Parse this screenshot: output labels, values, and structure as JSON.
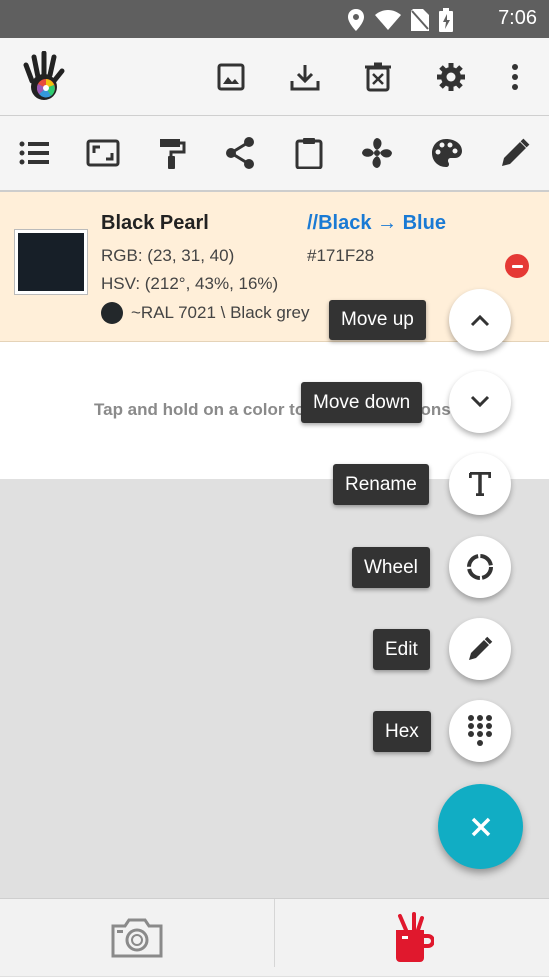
{
  "status_bar": {
    "time": "7:06",
    "icons": [
      "location-icon",
      "wifi-icon",
      "no-sim-icon",
      "battery-charging-icon"
    ]
  },
  "app_bar": {
    "actions": [
      "image-icon",
      "download-icon",
      "delete-icon",
      "settings-icon",
      "more-vert-icon"
    ]
  },
  "toolbar": {
    "actions": [
      "list-icon",
      "crop-icon",
      "paint-roller-icon",
      "share-icon",
      "clipboard-icon",
      "fan-icon",
      "palette-icon",
      "pencil-icon"
    ]
  },
  "color_card": {
    "name": "Black Pearl",
    "tag": "//Black → Blue",
    "rgb": "RGB: (23, 31, 40)",
    "hex": "#171F28",
    "hsv": "HSV: (212°, 43%, 16%)",
    "ral": "~RAL 7021 \\ Black grey",
    "swatch_color": "#171F28",
    "ral_dot_color": "#23282b"
  },
  "hint": {
    "text": "Tap and hold on a color to see more options"
  },
  "speed_dial": {
    "items": [
      {
        "label": "Move up",
        "icon": "chevron-up-icon"
      },
      {
        "label": "Move down",
        "icon": "chevron-down-icon"
      },
      {
        "label": "Rename",
        "icon": "text-icon"
      },
      {
        "label": "Wheel",
        "icon": "wheel-icon"
      },
      {
        "label": "Edit",
        "icon": "pencil-icon"
      },
      {
        "label": "Hex",
        "icon": "dialpad-icon"
      }
    ],
    "main_icon": "close-icon",
    "main_color": "#11ADC4"
  },
  "bottom_bar": {
    "tabs": [
      "camera-icon",
      "paint-cup-icon"
    ],
    "active_color": "#E0182D"
  }
}
